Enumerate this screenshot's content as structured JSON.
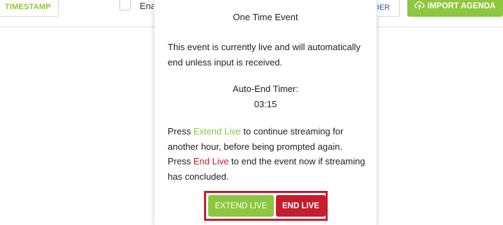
{
  "toolbar": {
    "timestamp_label": "TIMESTAMP",
    "enable_label": "Ena",
    "order_label": "DER",
    "import_label": "IMPORT AGENDA",
    "import_icon": "cloud-upload-icon"
  },
  "modal": {
    "title": "One Time Event",
    "intro": "This event is currently live and will automatically end unless input is received.",
    "timer_label": "Auto-End Timer:",
    "timer_value": "03:15",
    "info": {
      "press1": "Press ",
      "extend_kw": "Extend Live",
      "after_extend": " to continue streaming for another hour, before being prompted again.",
      "press2": " Press ",
      "end_kw": "End Live",
      "after_end": " to end the event now if streaming has concluded."
    },
    "buttons": {
      "extend_label": "EXTEND LIVE",
      "end_label": "END LIVE"
    }
  },
  "colors": {
    "accent_green": "#8dc63f",
    "danger_red": "#c51d2e",
    "link_blue": "#2a5aa8"
  }
}
